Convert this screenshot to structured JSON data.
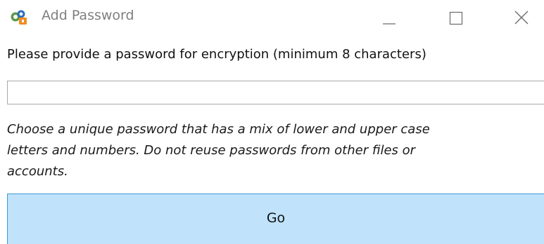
{
  "window": {
    "title": "Add Password",
    "icon": "app-logo-icon",
    "controls": [
      "minimize-icon",
      "maximize-icon",
      "close-icon"
    ]
  },
  "form": {
    "prompt": "Please provide a password for encryption (minimum 8 characters)",
    "password_value": "",
    "advice_lines": [
      "Choose a unique password that has a mix of lower and upper case",
      "letters and numbers. Do not reuse passwords from other files or",
      "accounts."
    ],
    "submit_label": "Go"
  },
  "colors": {
    "title_text": "#7f7f7f",
    "button_fill": "#c0e3fb",
    "button_border": "#3c98d6",
    "field_border": "#a8a8a8"
  }
}
